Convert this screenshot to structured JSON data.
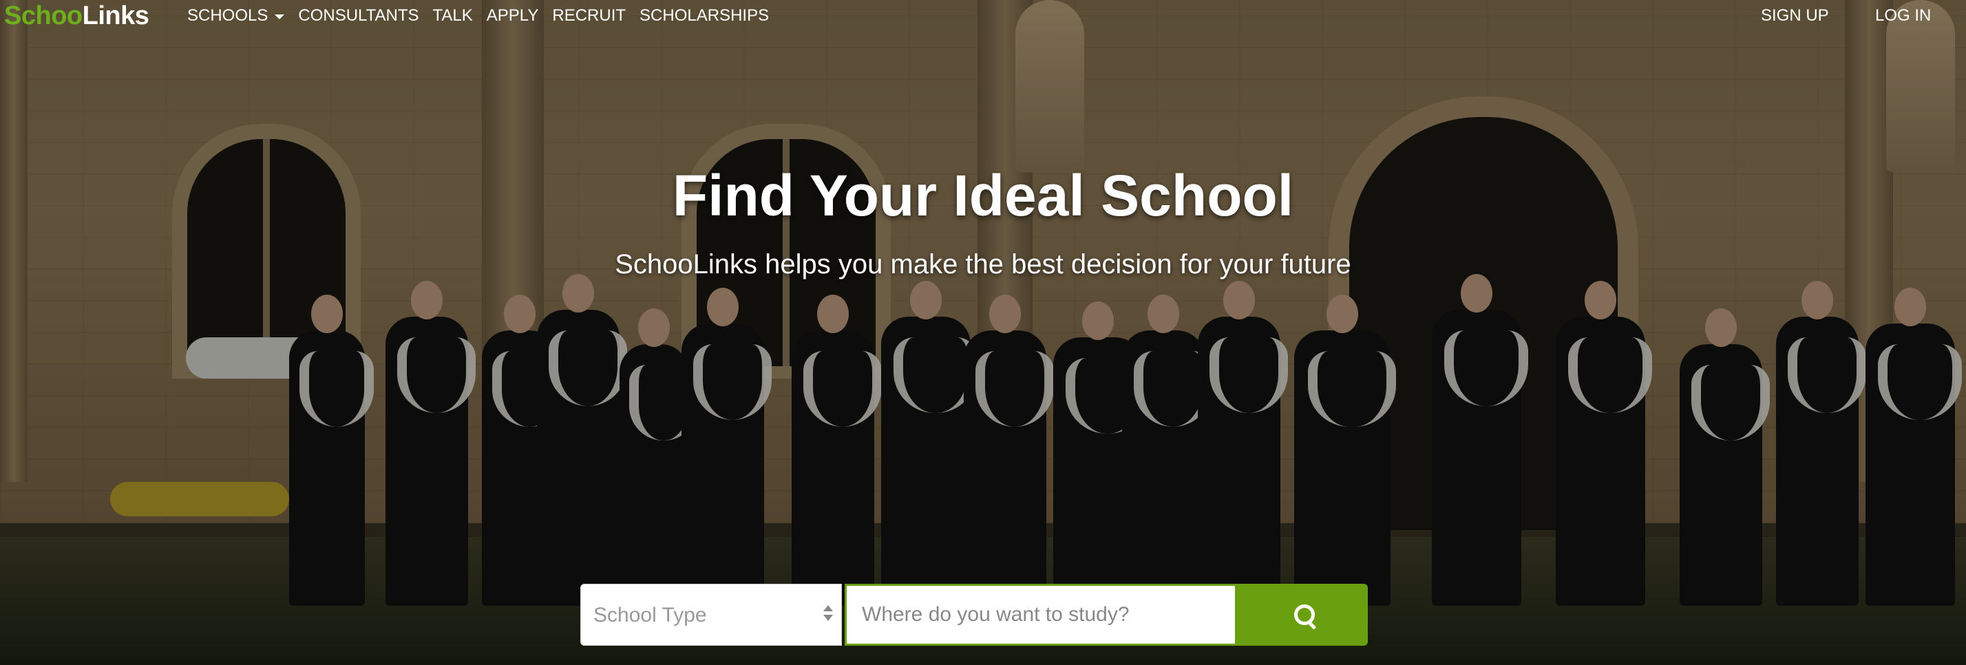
{
  "brand": {
    "logo_part1": "Schoo",
    "logo_part2": "Links"
  },
  "nav": {
    "items": [
      {
        "label": "SCHOOLS",
        "has_dropdown": true
      },
      {
        "label": "CONSULTANTS"
      },
      {
        "label": "TALK"
      },
      {
        "label": "APPLY"
      },
      {
        "label": "RECRUIT"
      },
      {
        "label": "SCHOLARSHIPS"
      }
    ],
    "sign_up": "SIGN UP",
    "log_in": "LOG IN"
  },
  "hero": {
    "title": "Find Your Ideal School",
    "subtitle": "SchooLinks helps you make the best decision for your future"
  },
  "search": {
    "school_type_placeholder": "School Type",
    "location_placeholder": "Where do you want to study?",
    "button_icon": "search-icon"
  },
  "colors": {
    "brand_green": "#6aa010",
    "logo_green": "#6fae1d",
    "text_white": "#ffffff"
  }
}
